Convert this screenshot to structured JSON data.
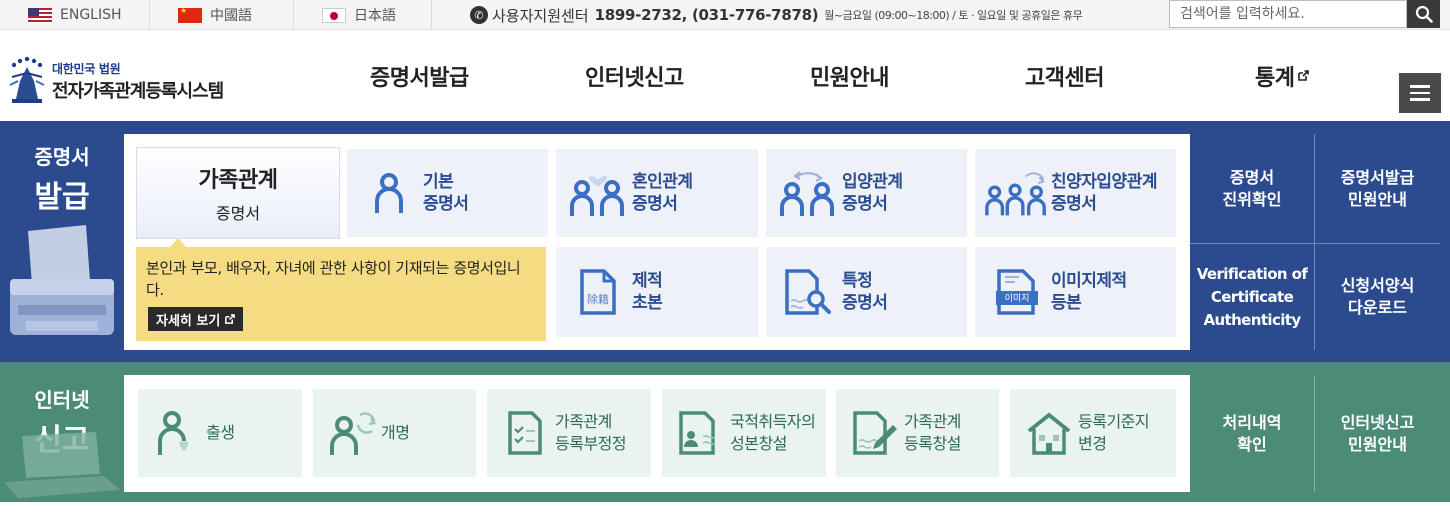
{
  "languages": [
    {
      "label": "ENGLISH",
      "flag": "us-flag"
    },
    {
      "label": "中國語",
      "flag": "china-flag"
    },
    {
      "label": "日本語",
      "flag": "japan-flag"
    }
  ],
  "support": {
    "label": "사용자지원센터",
    "phone": "1899-2732, (031-776-7878)",
    "hours": "월~금요일 (09:00~18:00) / 토 · 일요일 및 공휴일은 휴무"
  },
  "search": {
    "placeholder": "검색어를 입력하세요.",
    "icon": "search-icon"
  },
  "logo": {
    "sub": "대한민국 법원",
    "main": "전자가족관계등록시스템"
  },
  "nav": [
    "증명서발급",
    "인터넷신고",
    "민원안내",
    "고객센터",
    "통계"
  ],
  "certificate": {
    "title_line1": "증명서",
    "title_line2": "발급",
    "active": {
      "line1": "가족관계",
      "line2": "증명서"
    },
    "tooltip": {
      "desc": "본인과 부모, 배우자, 자녀에 관한 사항이 기재되는 증명서입니다.",
      "more": "자세히 보기"
    },
    "items": [
      {
        "line1": "기본",
        "line2": "증명서",
        "icon": "person-icon"
      },
      {
        "line1": "혼인관계",
        "line2": "증명서",
        "icon": "couple-heart-icon"
      },
      {
        "line1": "입양관계",
        "line2": "증명서",
        "icon": "couple-arrow-icon"
      },
      {
        "line1": "친양자입양관계",
        "line2": "증명서",
        "icon": "family-arrow-icon"
      },
      {
        "line1": "제적",
        "line2": "초본",
        "icon": "document-icon"
      },
      {
        "line1": "특정",
        "line2": "증명서",
        "icon": "document-search-icon"
      },
      {
        "line1": "이미지제적",
        "line2": "등본",
        "icon": "image-document-icon"
      }
    ],
    "side": [
      {
        "line1": "증명서",
        "line2": "진위확인"
      },
      {
        "line1": "증명서발급",
        "line2": "민원안내"
      },
      {
        "line1": "Verification of",
        "line2": "Certificate",
        "line3": "Authenticity"
      },
      {
        "line1": "신청서양식",
        "line2": "다운로드"
      }
    ],
    "colors": {
      "bg": "#2c4b8e",
      "card": "#eef1f7",
      "label": "#2a4d91",
      "tooltip": "#f5dc82"
    }
  },
  "report": {
    "title_line1": "인터넷",
    "title_line2": "신고",
    "items": [
      {
        "line1": "출생",
        "line2": "",
        "icon": "baby-heart-icon"
      },
      {
        "line1": "개명",
        "line2": "",
        "icon": "person-refresh-icon"
      },
      {
        "line1": "가족관계",
        "line2": "등록부정정",
        "icon": "checklist-icon"
      },
      {
        "line1": "국적취득자의",
        "line2": "성본창설",
        "icon": "id-card-icon"
      },
      {
        "line1": "가족관계",
        "line2": "등록창설",
        "icon": "document-pen-icon"
      },
      {
        "line1": "등록기준지",
        "line2": "변경",
        "icon": "house-icon"
      }
    ],
    "side": [
      {
        "line1": "처리내역",
        "line2": "확인"
      },
      {
        "line1": "인터넷신고",
        "line2": "민원안내"
      }
    ],
    "colors": {
      "bg": "#4d8b79",
      "card": "#e9f3ef",
      "label": "#2e6a57"
    }
  }
}
